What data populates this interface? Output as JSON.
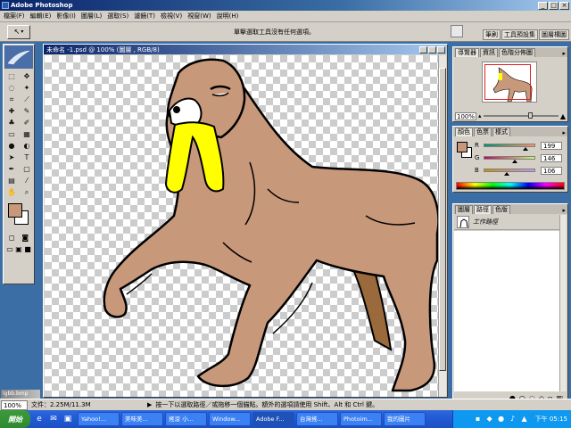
{
  "window": {
    "title": "Adobe Photoshop"
  },
  "menu": [
    "檔案(F)",
    "編輯(E)",
    "影像(I)",
    "圖層(L)",
    "選取(S)",
    "濾鏡(T)",
    "檢視(V)",
    "視窗(W)",
    "說明(H)"
  ],
  "options_bar": {
    "hint": "單擊選取工具沒有任何選項。",
    "well_tabs": [
      "筆刷",
      "工具預設集",
      "圖層構圖"
    ]
  },
  "document": {
    "title": "未命名 -1.psd @ 100% (圖層 , RGB/8)"
  },
  "navigator": {
    "tabs": [
      "導覽器",
      "資訊",
      "色階分佈圖"
    ],
    "zoom": "100%"
  },
  "color_panel": {
    "tabs": [
      "顏色",
      "色票",
      "樣式"
    ],
    "r": {
      "label": "R",
      "value": "199"
    },
    "g": {
      "label": "G",
      "value": "146"
    },
    "b": {
      "label": "B",
      "value": "106"
    },
    "foreground": "#c8987a"
  },
  "paths_panel": {
    "tabs": [
      "圖層",
      "路徑",
      "色版"
    ],
    "items": [
      {
        "name": "工作路徑"
      }
    ]
  },
  "status": {
    "zoom": "100%",
    "doc": "文件：2.25M/11.3M",
    "message": "按一下以選取路徑／或拖移一個錨點。額外的選項請使用 Shift、Alt 和 Ctrl 鍵。"
  },
  "minimized_doc": "lgbb.bmp",
  "taskbar": {
    "start": "開始",
    "tasks": [
      {
        "label": "Yahoo!..."
      },
      {
        "label": "美味美..."
      },
      {
        "label": "搖滾 小..."
      },
      {
        "label": "Window..."
      },
      {
        "label": "Adobe F..."
      },
      {
        "label": "台灣搖..."
      },
      {
        "label": "Photoim..."
      },
      {
        "label": "我的圖片"
      }
    ],
    "clock": "下午 05:15"
  },
  "colors": {
    "accent": "#0a246a",
    "chrome": "#d4d0c8",
    "dog_fur": "#c8987a",
    "towel": "#ffff00"
  }
}
